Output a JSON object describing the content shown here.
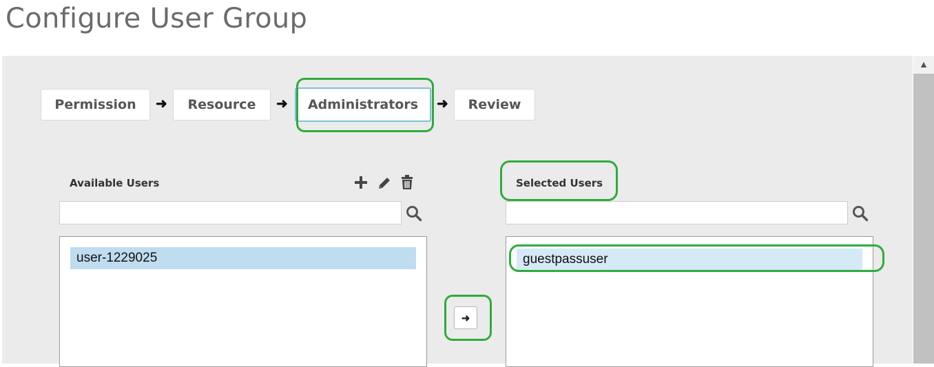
{
  "page": {
    "title": "Configure User Group"
  },
  "wizard": {
    "steps": [
      {
        "label": "Permission"
      },
      {
        "label": "Resource"
      },
      {
        "label": "Administrators",
        "active": true
      },
      {
        "label": "Review"
      }
    ],
    "arrow_glyph": "➜"
  },
  "available_users": {
    "label": "Available Users",
    "search_placeholder": "",
    "actions": [
      "plus-icon",
      "pencil-icon",
      "trash-icon"
    ],
    "items": [
      "user-1229025"
    ]
  },
  "selected_users": {
    "label": "Selected Users",
    "search_placeholder": "",
    "items": [
      "guestpassuser"
    ]
  },
  "transfer": {
    "glyph": "➜"
  },
  "colors": {
    "panel_bg": "#ebebeb",
    "annotation_green": "#2eab3c",
    "active_step_border": "#7fbfdb",
    "available_item_bg": "#bfdcf0",
    "selected_item_bg": "#d6e9f6",
    "title_text": "#6b6b6b"
  }
}
